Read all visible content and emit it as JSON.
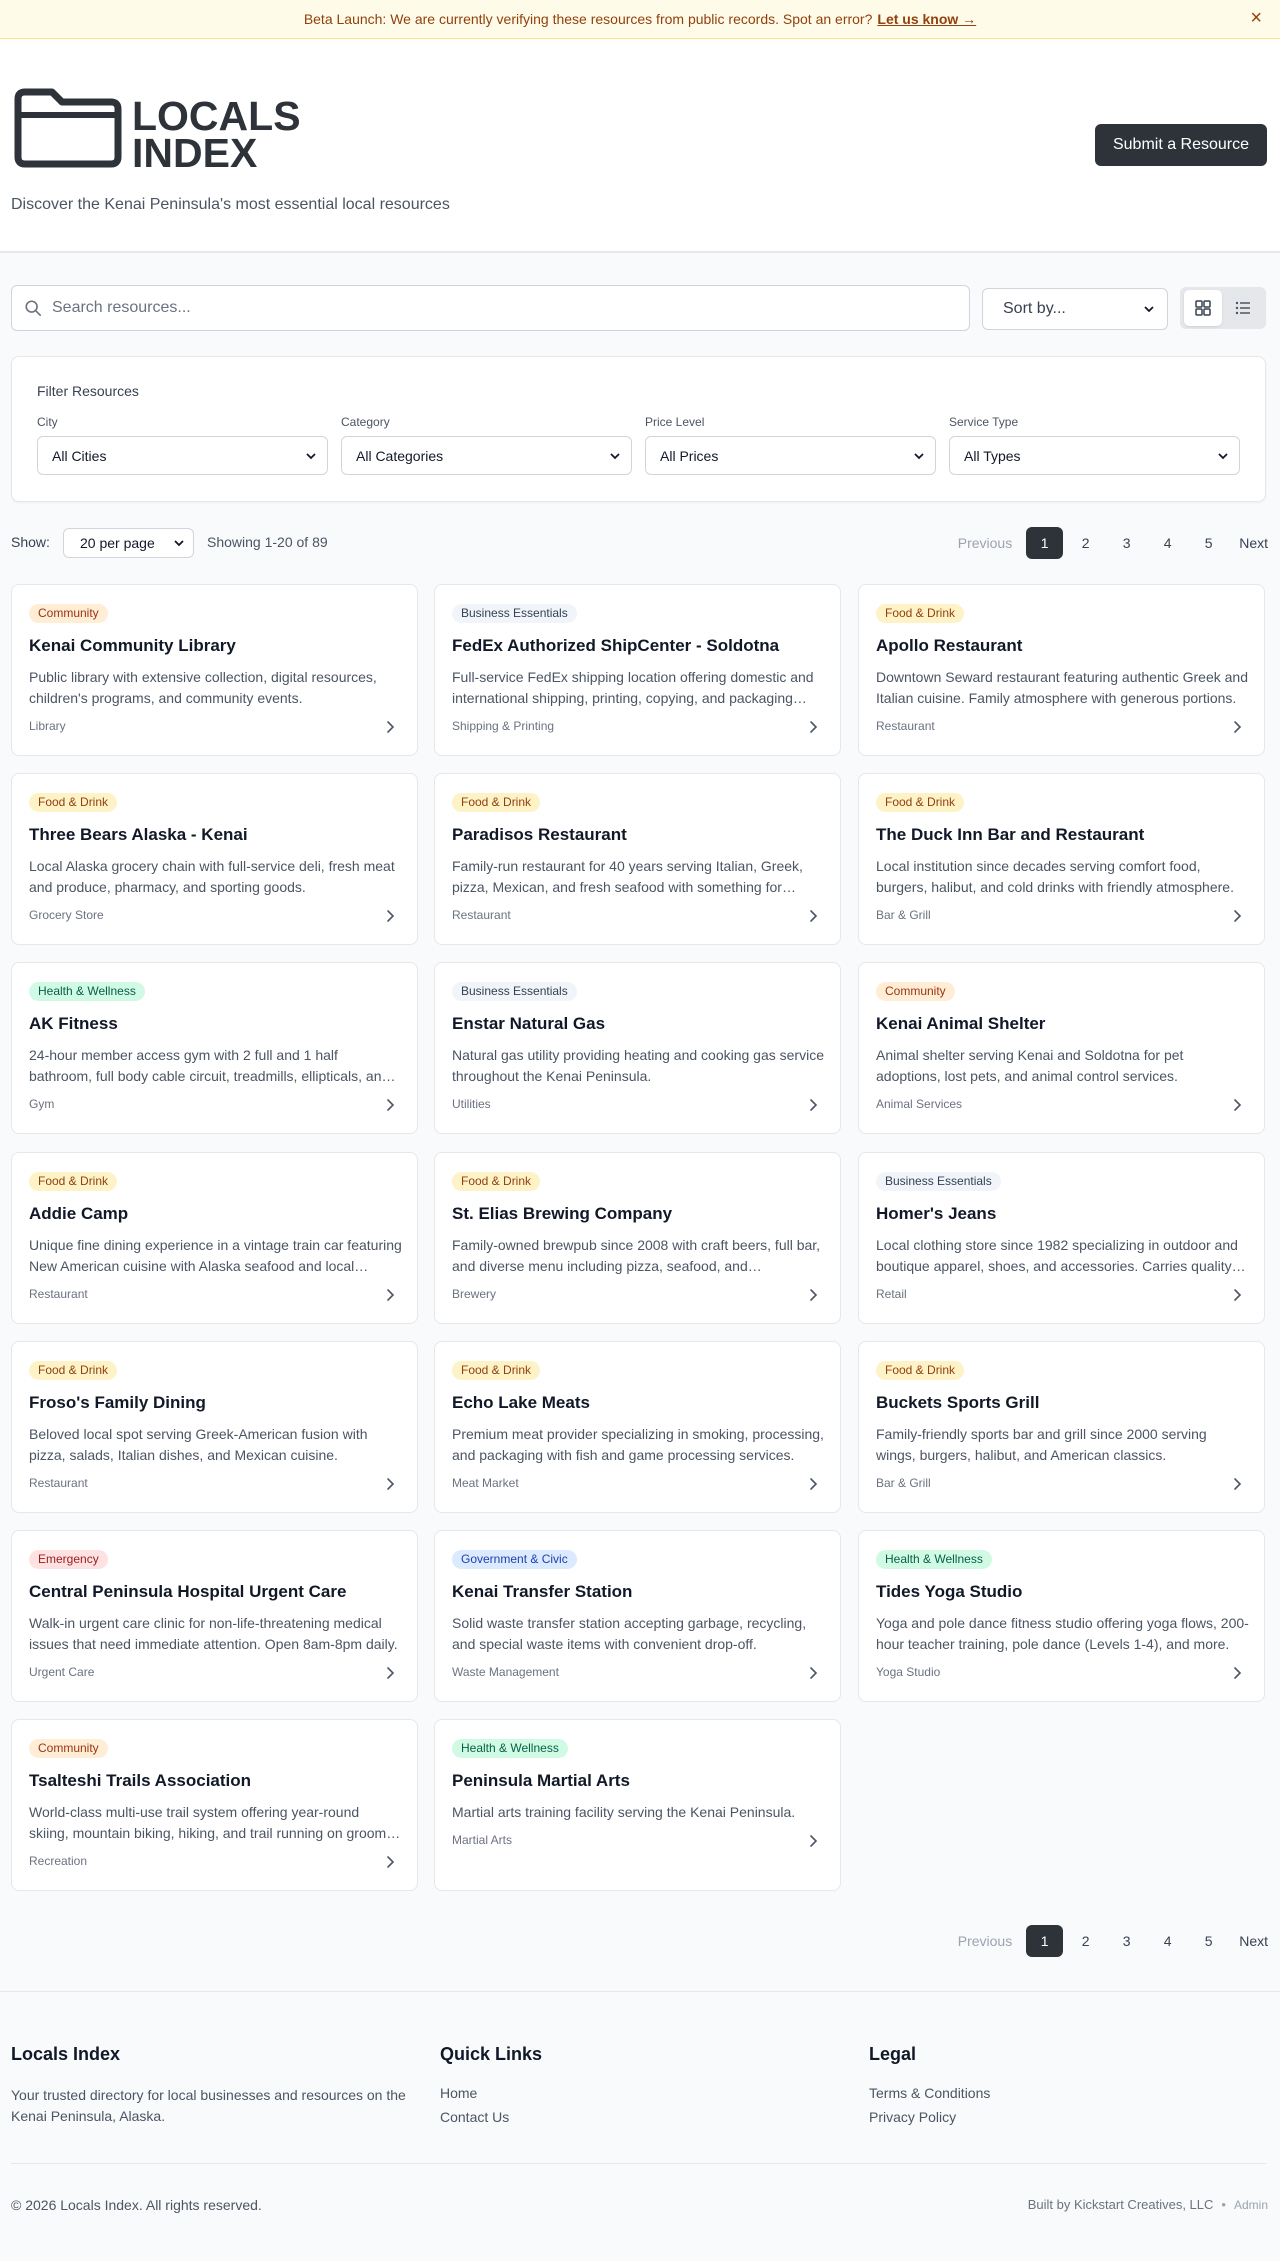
{
  "banner": {
    "message": "Beta Launch: We are currently verifying these resources from public records. Spot an error?",
    "link": "Let us know →",
    "close": "×"
  },
  "header": {
    "logo_line1": "LOCALS",
    "logo_line2": "INDEX",
    "tagline": "Discover the Kenai Peninsula's most essential local resources",
    "submit_label": "Submit a Resource"
  },
  "search": {
    "placeholder": "Search resources...",
    "sort_label": "Sort by..."
  },
  "filters": {
    "title": "Filter Resources",
    "city": {
      "label": "City",
      "value": "All Cities"
    },
    "category": {
      "label": "Category",
      "value": "All Categories"
    },
    "price": {
      "label": "Price Level",
      "value": "All Prices"
    },
    "type": {
      "label": "Service Type",
      "value": "All Types"
    }
  },
  "pagination": {
    "show_label": "Show:",
    "per_page": "20 per page",
    "showing": "Showing 1-20 of 89",
    "previous": "Previous",
    "next": "Next",
    "pages": [
      "1",
      "2",
      "3",
      "4",
      "5"
    ],
    "current": "1"
  },
  "cards": [
    {
      "category": "Community",
      "style": "community",
      "title": "Kenai Community Library",
      "description": "Public library with extensive collection, digital resources, children's programs, and community events.",
      "type": "Library"
    },
    {
      "category": "Business Essentials",
      "style": "business",
      "title": "FedEx Authorized ShipCenter - Soldotna",
      "description": "Full-service FedEx shipping location offering domestic and international shipping, printing, copying, and packaging services.",
      "type": "Shipping & Printing"
    },
    {
      "category": "Food & Drink",
      "style": "food",
      "title": "Apollo Restaurant",
      "description": "Downtown Seward restaurant featuring authentic Greek and Italian cuisine. Family atmosphere with generous portions.",
      "type": "Restaurant"
    },
    {
      "category": "Food & Drink",
      "style": "food",
      "title": "Three Bears Alaska - Kenai",
      "description": "Local Alaska grocery chain with full-service deli, fresh meat and produce, pharmacy, and sporting goods.",
      "type": "Grocery Store"
    },
    {
      "category": "Food & Drink",
      "style": "food",
      "title": "Paradisos Restaurant",
      "description": "Family-run restaurant for 40 years serving Italian, Greek, pizza, Mexican, and fresh seafood with something for everyone.",
      "type": "Restaurant"
    },
    {
      "category": "Food & Drink",
      "style": "food",
      "title": "The Duck Inn Bar and Restaurant",
      "description": "Local institution since decades serving comfort food, burgers, halibut, and cold drinks with friendly atmosphere.",
      "type": "Bar & Grill"
    },
    {
      "category": "Health & Wellness",
      "style": "health",
      "title": "AK Fitness",
      "description": "24-hour member access gym with 2 full and 1 half bathroom, full body cable circuit, treadmills, ellipticals, and free weights.",
      "type": "Gym"
    },
    {
      "category": "Business Essentials",
      "style": "business",
      "title": "Enstar Natural Gas",
      "description": "Natural gas utility providing heating and cooking gas service throughout the Kenai Peninsula.",
      "type": "Utilities"
    },
    {
      "category": "Community",
      "style": "community",
      "title": "Kenai Animal Shelter",
      "description": "Animal shelter serving Kenai and Soldotna for pet adoptions, lost pets, and animal control services.",
      "type": "Animal Services"
    },
    {
      "category": "Food & Drink",
      "style": "food",
      "title": "Addie Camp",
      "description": "Unique fine dining experience in a vintage train car featuring New American cuisine with Alaska seafood and local ingredients.",
      "type": "Restaurant"
    },
    {
      "category": "Food & Drink",
      "style": "food",
      "title": "St. Elias Brewing Company",
      "description": "Family-owned brewpub since 2008 with craft beers, full bar, and diverse menu including pizza, seafood, and sandwiches.",
      "type": "Brewery"
    },
    {
      "category": "Business Essentials",
      "style": "business",
      "title": "Homer's Jeans",
      "description": "Local clothing store since 1982 specializing in outdoor and boutique apparel, shoes, and accessories. Carries quality brands.",
      "type": "Retail"
    },
    {
      "category": "Food & Drink",
      "style": "food",
      "title": "Froso's Family Dining",
      "description": "Beloved local spot serving Greek-American fusion with pizza, salads, Italian dishes, and Mexican cuisine.",
      "type": "Restaurant"
    },
    {
      "category": "Food & Drink",
      "style": "food",
      "title": "Echo Lake Meats",
      "description": "Premium meat provider specializing in smoking, processing, and packaging with fish and game processing services.",
      "type": "Meat Market"
    },
    {
      "category": "Food & Drink",
      "style": "food",
      "title": "Buckets Sports Grill",
      "description": "Family-friendly sports bar and grill since 2000 serving wings, burgers, halibut, and American classics.",
      "type": "Bar & Grill"
    },
    {
      "category": "Emergency",
      "style": "emergency",
      "title": "Central Peninsula Hospital Urgent Care",
      "description": "Walk-in urgent care clinic for non-life-threatening medical issues that need immediate attention. Open 8am-8pm daily.",
      "type": "Urgent Care"
    },
    {
      "category": "Government & Civic",
      "style": "gov",
      "title": "Kenai Transfer Station",
      "description": "Solid waste transfer station accepting garbage, recycling, and special waste items with convenient drop-off.",
      "type": "Waste Management"
    },
    {
      "category": "Health & Wellness",
      "style": "health",
      "title": "Tides Yoga Studio",
      "description": "Yoga and pole dance fitness studio offering yoga flows, 200-hour teacher training, pole dance (Levels 1-4), and more.",
      "type": "Yoga Studio"
    },
    {
      "category": "Community",
      "style": "community",
      "title": "Tsalteshi Trails Association",
      "description": "World-class multi-use trail system offering year-round skiing, mountain biking, hiking, and trail running on groomed trails.",
      "type": "Recreation"
    },
    {
      "category": "Health & Wellness",
      "style": "health",
      "title": "Peninsula Martial Arts",
      "description": "Martial arts training facility serving the Kenai Peninsula.",
      "type": "Martial Arts"
    }
  ],
  "footer": {
    "about_title": "Locals Index",
    "about_text": "Your trusted directory for local businesses and resources on the Kenai Peninsula, Alaska.",
    "links_title": "Quick Links",
    "links": [
      "Home",
      "Contact Us"
    ],
    "legal_title": "Legal",
    "legal": [
      "Terms & Conditions",
      "Privacy Policy"
    ],
    "copyright": "© 2026 Locals Index. All rights reserved.",
    "built_by": "Built by Kickstart Creatives, LLC",
    "separator": "•",
    "admin": "Admin"
  }
}
